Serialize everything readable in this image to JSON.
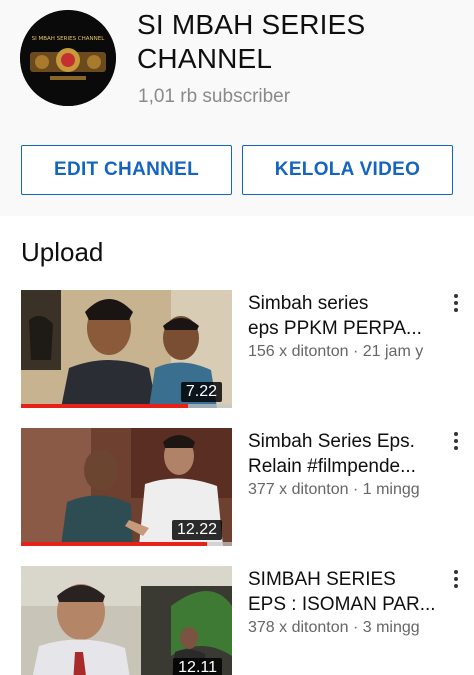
{
  "channel": {
    "name_line1": "SI MBAH SERIES",
    "name_line2": "CHANNEL",
    "subscribers": "1,01 rb subscriber",
    "avatar_text": "SI MBAH SERIES CHANNEL"
  },
  "actions": {
    "edit_label": "EDIT CHANNEL",
    "manage_label": "KELOLA VIDEO"
  },
  "section": {
    "title": "Upload"
  },
  "videos": [
    {
      "title_line1": "Simbah series",
      "title_line2": "eps PPKM PERPA...",
      "meta": "156 x ditonton · 21 jam y",
      "duration": "7.22",
      "progress": 0.79
    },
    {
      "title_line1": "Simbah Series Eps.",
      "title_line2": "Relain #filmpende...",
      "meta": "377 x ditonton · 1 mingg",
      "duration": "12.22",
      "progress": 0.88
    },
    {
      "title_line1": "SIMBAH SERIES",
      "title_line2": "EPS : ISOMAN PAR...",
      "meta": "378 x ditonton · 3 mingg",
      "duration": "12.11",
      "progress": 0
    }
  ],
  "colors": {
    "accent": "#1565c0",
    "progress": "#e62117",
    "meta": "#666666"
  },
  "icons": {
    "menu": "more-vert-icon"
  }
}
